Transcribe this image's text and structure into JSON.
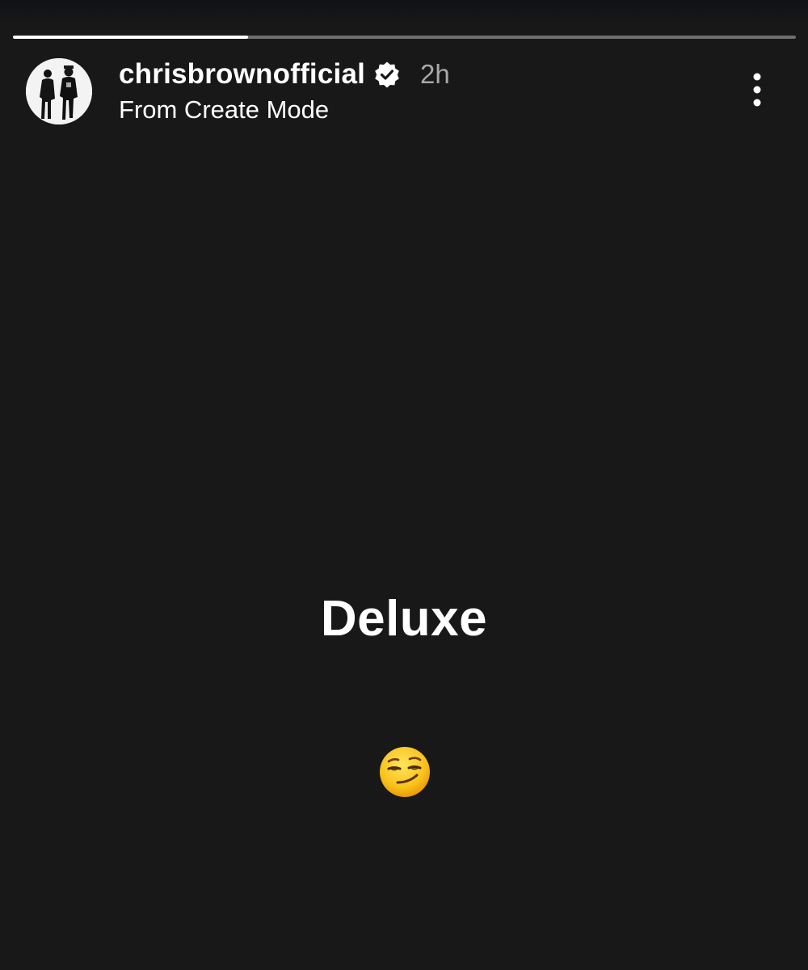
{
  "story": {
    "progress_fraction": 0.3,
    "username": "chrisbrownofficial",
    "verified_icon": "verified-badge-icon",
    "time_ago": "2h",
    "subtitle": "From Create Mode",
    "headline": "Deluxe",
    "emoji": "smirking-face-emoji",
    "more_icon": "more-vertical-icon"
  },
  "colors": {
    "background": "#181818",
    "text": "#ffffff",
    "muted_text": "#a8a8a8",
    "progress_track": "#6b6b6b",
    "progress_fill": "#ffffff"
  }
}
